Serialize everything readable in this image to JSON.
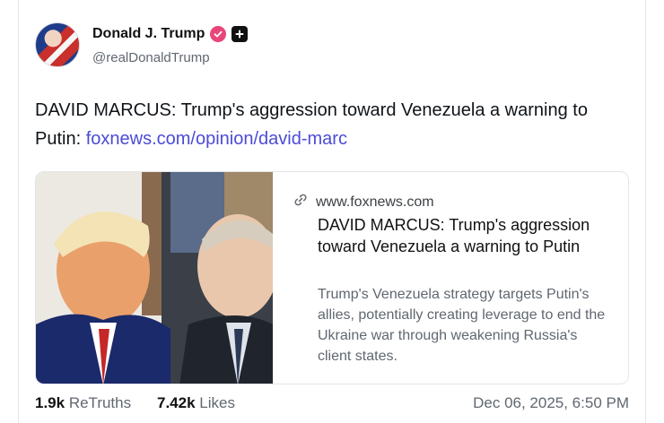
{
  "author": {
    "display_name": "Donald J. Trump",
    "handle": "@realDonaldTrump"
  },
  "post": {
    "text": "DAVID MARCUS: Trump's aggression toward Venezuela a warning to Putin:",
    "link_text": "foxnews.com/opinion/david-marc"
  },
  "link_card": {
    "domain": "www.foxnews.com",
    "title": "DAVID MARCUS: Trump's aggression toward Venezuela a warning to Putin",
    "description": "Trump's Venezuela strategy targets Putin's allies, potentially creating leverage to end the Ukraine war through weakening Russia's client states."
  },
  "stats": {
    "retruths_count": "1.9k",
    "retruths_label": "ReTruths",
    "likes_count": "7.42k",
    "likes_label": "Likes",
    "timestamp": "Dec 06, 2025, 6:50 PM"
  },
  "colors": {
    "link": "#4b4bd6",
    "verified_badge": "#e8467a"
  }
}
